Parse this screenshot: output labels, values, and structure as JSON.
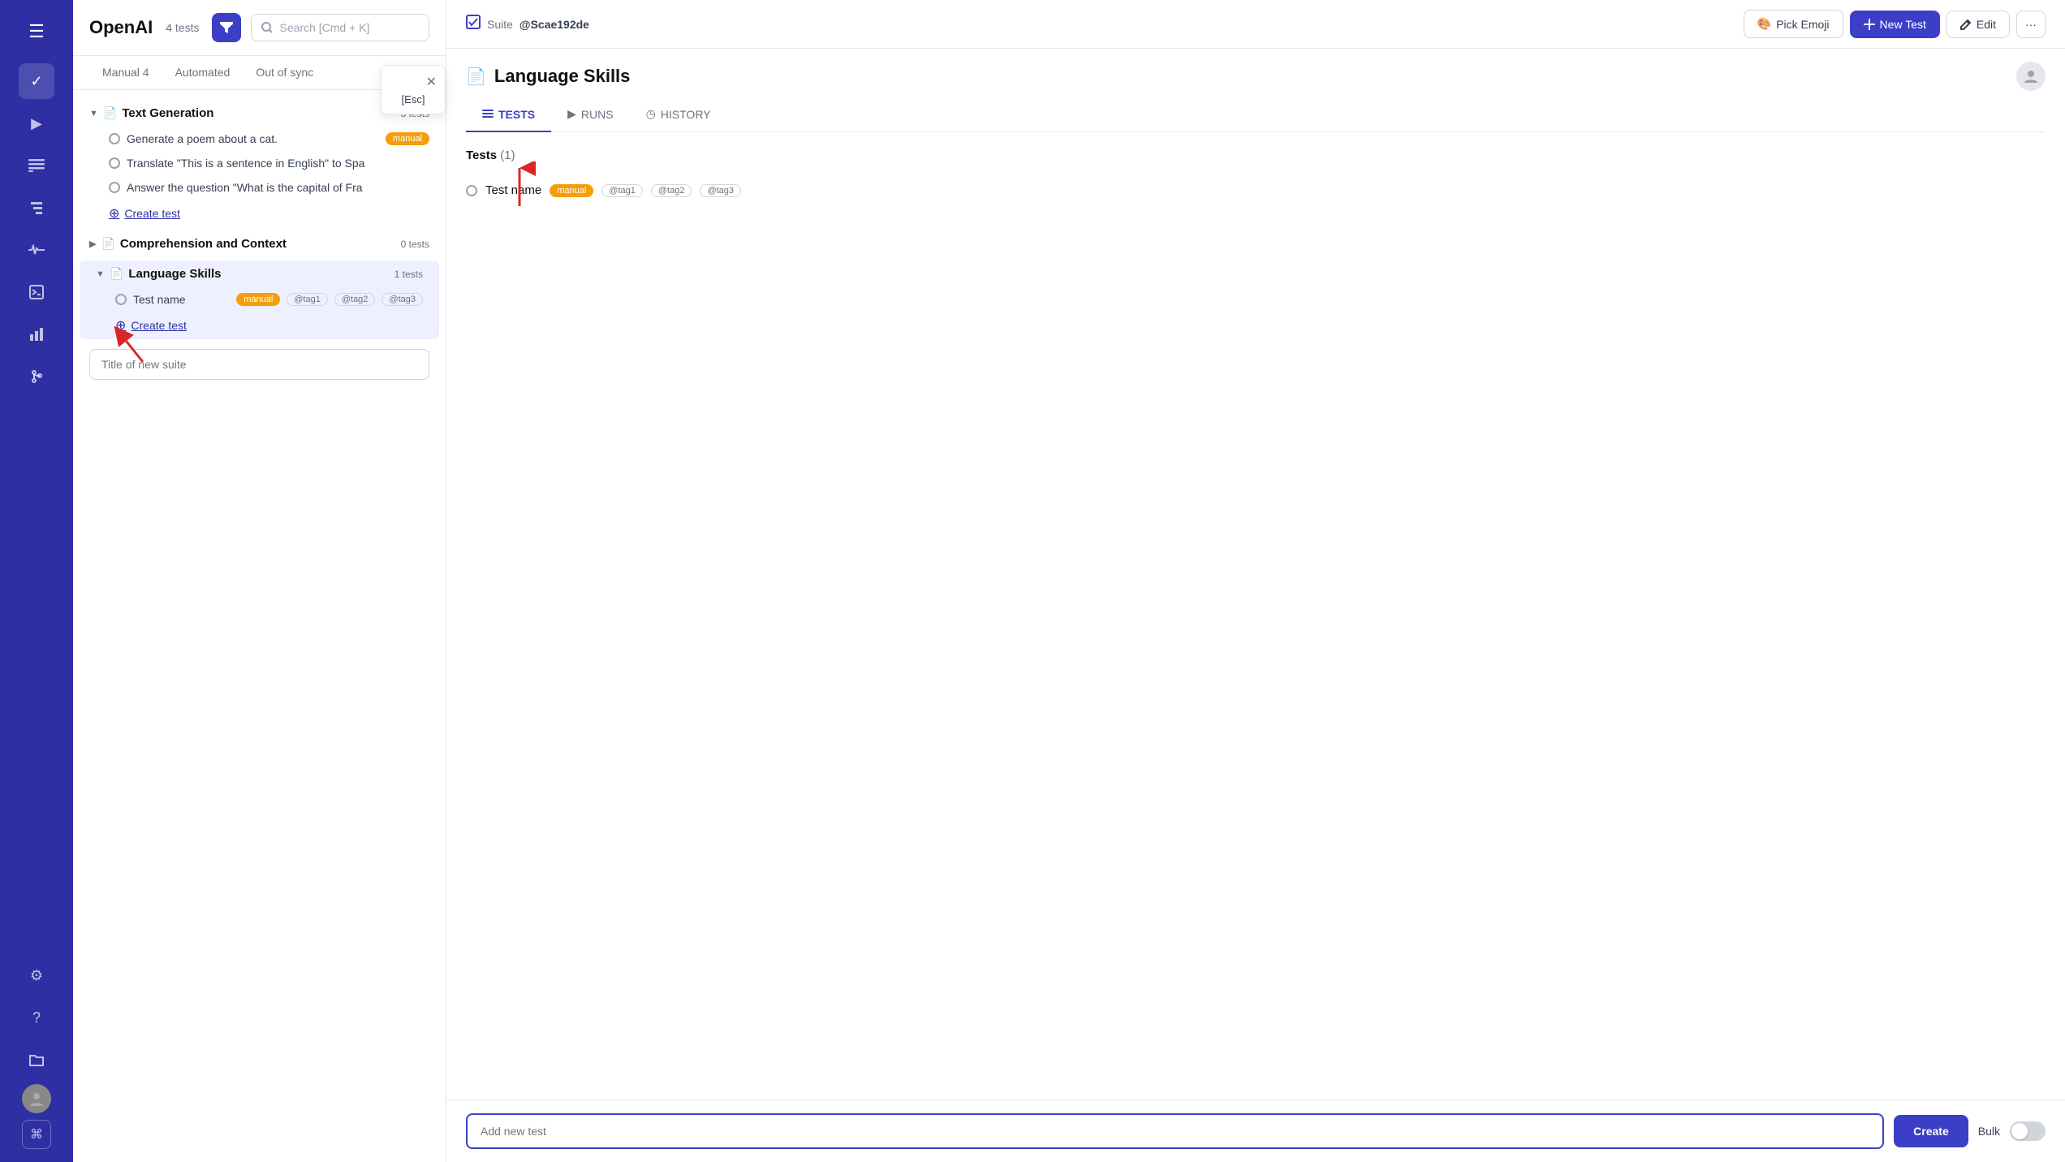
{
  "leftNav": {
    "icons": [
      {
        "name": "hamburger-icon",
        "symbol": "☰",
        "active": false
      },
      {
        "name": "check-icon",
        "symbol": "✓",
        "active": true
      },
      {
        "name": "play-icon",
        "symbol": "▶",
        "active": false
      },
      {
        "name": "list-icon",
        "symbol": "≡",
        "active": false
      },
      {
        "name": "steps-icon",
        "symbol": "⤵",
        "active": false
      },
      {
        "name": "activity-icon",
        "symbol": "⚡",
        "active": false
      },
      {
        "name": "terminal-icon",
        "symbol": "⊡",
        "active": false
      },
      {
        "name": "chart-icon",
        "symbol": "▦",
        "active": false
      },
      {
        "name": "git-icon",
        "symbol": "⎇",
        "active": false
      },
      {
        "name": "gear-icon",
        "symbol": "⚙",
        "active": false
      },
      {
        "name": "help-icon",
        "symbol": "?",
        "active": false
      },
      {
        "name": "folder-icon",
        "symbol": "⊞",
        "active": false
      }
    ],
    "cmdKey": "⌘"
  },
  "sidebar": {
    "appTitle": "OpenAI",
    "testCount": "4 tests",
    "searchPlaceholder": "Search [Cmd + K]",
    "tabs": [
      {
        "id": "manual",
        "label": "Manual 4",
        "active": false
      },
      {
        "id": "automated",
        "label": "Automated",
        "active": false
      },
      {
        "id": "out-of-sync",
        "label": "Out of sync",
        "active": false
      }
    ],
    "suites": [
      {
        "name": "Text Generation",
        "count": "3 tests",
        "expanded": true,
        "active": false,
        "tests": [
          {
            "name": "Generate a poem about a cat.",
            "tags": [
              "manual"
            ]
          },
          {
            "name": "Translate \"This is a sentence in English\" to Spa"
          },
          {
            "name": "Answer the question \"What is the capital of Fra"
          }
        ],
        "createLabel": "Create test"
      },
      {
        "name": "Comprehension and Context",
        "count": "0 tests",
        "expanded": false,
        "active": false,
        "tests": [],
        "createLabel": "Create test"
      },
      {
        "name": "Language Skills",
        "count": "1 tests",
        "expanded": true,
        "active": true,
        "tests": [
          {
            "name": "Test name",
            "tags": [
              "manual",
              "@tag1",
              "@tag2",
              "@tag3"
            ]
          }
        ],
        "createLabel": "Create test"
      }
    ],
    "newSuitePlaceholder": "Title of new suite",
    "escPopup": {
      "closeSymbol": "✕",
      "label": "[Esc]"
    }
  },
  "header": {
    "suiteLabel": "Suite",
    "suiteName": "@Scae192de",
    "pickEmojiLabel": "Pick Emoji",
    "newTestLabel": "New Test",
    "editLabel": "Edit",
    "moreSymbol": "···"
  },
  "pageTitle": {
    "icon": "📄",
    "title": "Language Skills"
  },
  "contentTabs": [
    {
      "id": "tests",
      "label": "TESTS",
      "icon": "≡",
      "active": true
    },
    {
      "id": "runs",
      "label": "RUNS",
      "icon": "▶",
      "active": false
    },
    {
      "id": "history",
      "label": "HISTORY",
      "icon": "◷",
      "active": false
    }
  ],
  "testsSection": {
    "header": "Tests",
    "count": "(1)",
    "testRow": {
      "name": "Test name",
      "tags": [
        "manual",
        "@tag1",
        "@tag2",
        "@tag3"
      ]
    }
  },
  "bottomBar": {
    "inputPlaceholder": "Add new test",
    "createLabel": "Create",
    "bulkLabel": "Bulk"
  }
}
